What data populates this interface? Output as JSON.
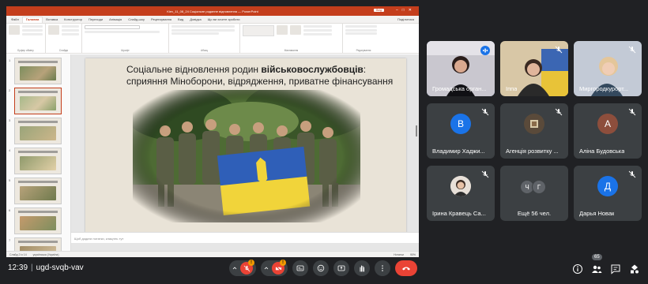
{
  "powerpoint": {
    "window_title": "Kiev_11_08_24 Соціальне родинне відновлення — PowerPoint",
    "login_label": "Вхід",
    "tabs": [
      "Файл",
      "Головна",
      "Вставка",
      "Конструктор",
      "Переходи",
      "Анімація",
      "Слайд-шоу",
      "Рецензування",
      "Вид",
      "Довідка",
      "Що ви хочете зробити"
    ],
    "share_label": "Поділитися",
    "ribbon_groups": [
      "Буфер обміну",
      "Слайди",
      "Шрифт",
      "Абзац",
      "Малювання",
      "Редагування"
    ],
    "notes_placeholder": "Щоб додати нотатки, клацніть тут",
    "status": {
      "slide_counter": "Слайд 2 із 14",
      "language": "українська (Україна)",
      "notes_label": "Нотатки",
      "zoom": "90%"
    },
    "thumbnail_numbers": [
      "1",
      "2",
      "3",
      "4",
      "5",
      "6",
      "7"
    ],
    "slide": {
      "title_normal": "Соціальне відновлення родин ",
      "title_bold": "військовослужбовців",
      "title_rest": ": сприяння Міноборони, відрядження, приватне фінансування"
    }
  },
  "participants": [
    {
      "name": "Громадська орган...",
      "type": "video",
      "speaking": true
    },
    {
      "name": "Іппа",
      "type": "video"
    },
    {
      "name": "Миргородкурорт...",
      "type": "video"
    },
    {
      "name": "Владимир Хаджи...",
      "type": "initial",
      "initial": "В",
      "color": "#1a73e8"
    },
    {
      "name": "Агенція розвитку ...",
      "type": "logo"
    },
    {
      "name": "Аліна Будовська",
      "type": "initial",
      "initial": "А",
      "color": "#8d4e3c"
    },
    {
      "name": "Ірина Кравець Са...",
      "type": "photo"
    },
    {
      "name": "Ещё 56 чел.",
      "type": "more",
      "initials": [
        "Ч",
        "Г"
      ]
    },
    {
      "name": "Дарья Новак",
      "type": "initial",
      "initial": "Д",
      "color": "#1a73e8"
    }
  ],
  "meeting": {
    "time": "12:39",
    "code": "ugd-svqb-vav",
    "participants_count": "65"
  },
  "icons": [
    "mic-off-icon",
    "camera-off-icon",
    "captions-icon",
    "emoji-icon",
    "present-icon",
    "raise-hand-icon",
    "more-options-icon",
    "end-call-icon",
    "info-icon",
    "people-icon",
    "chat-icon",
    "activities-icon"
  ],
  "colors": {
    "accent": "#c43e1c",
    "meet_bg": "#202124",
    "tile_bg": "#3c4043",
    "end_call": "#ea4335"
  }
}
